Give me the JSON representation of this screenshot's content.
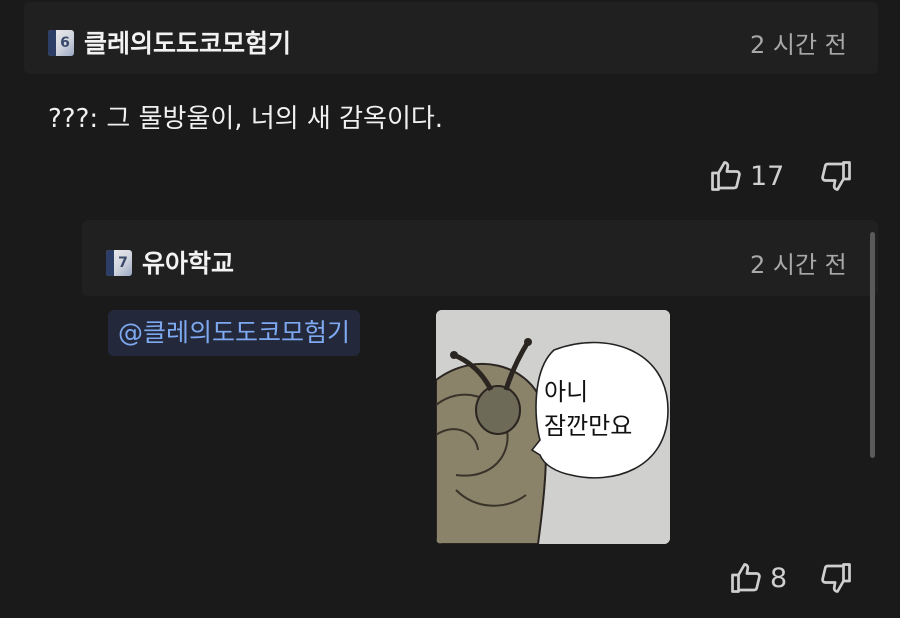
{
  "comment": {
    "level": "6",
    "author": "클레의도도코모험기",
    "time": "2 시간 전",
    "text": "???: 그 물방울이, 너의 새 감옥이다.",
    "likes": "17"
  },
  "reply": {
    "level": "7",
    "author": "유아학교",
    "time": "2 시간 전",
    "mention": "@클레의도도코모험기",
    "likes": "8",
    "sticker_text_line1": "아니",
    "sticker_text_line2": "잠깐만요"
  },
  "colors": {
    "background": "#1a1a1a",
    "header_bar": "#202020",
    "mention_text": "#7ea8f0",
    "mention_bg": "#23293a"
  },
  "icons": {
    "like": "thumbs-up-icon",
    "dislike": "thumbs-down-icon"
  }
}
